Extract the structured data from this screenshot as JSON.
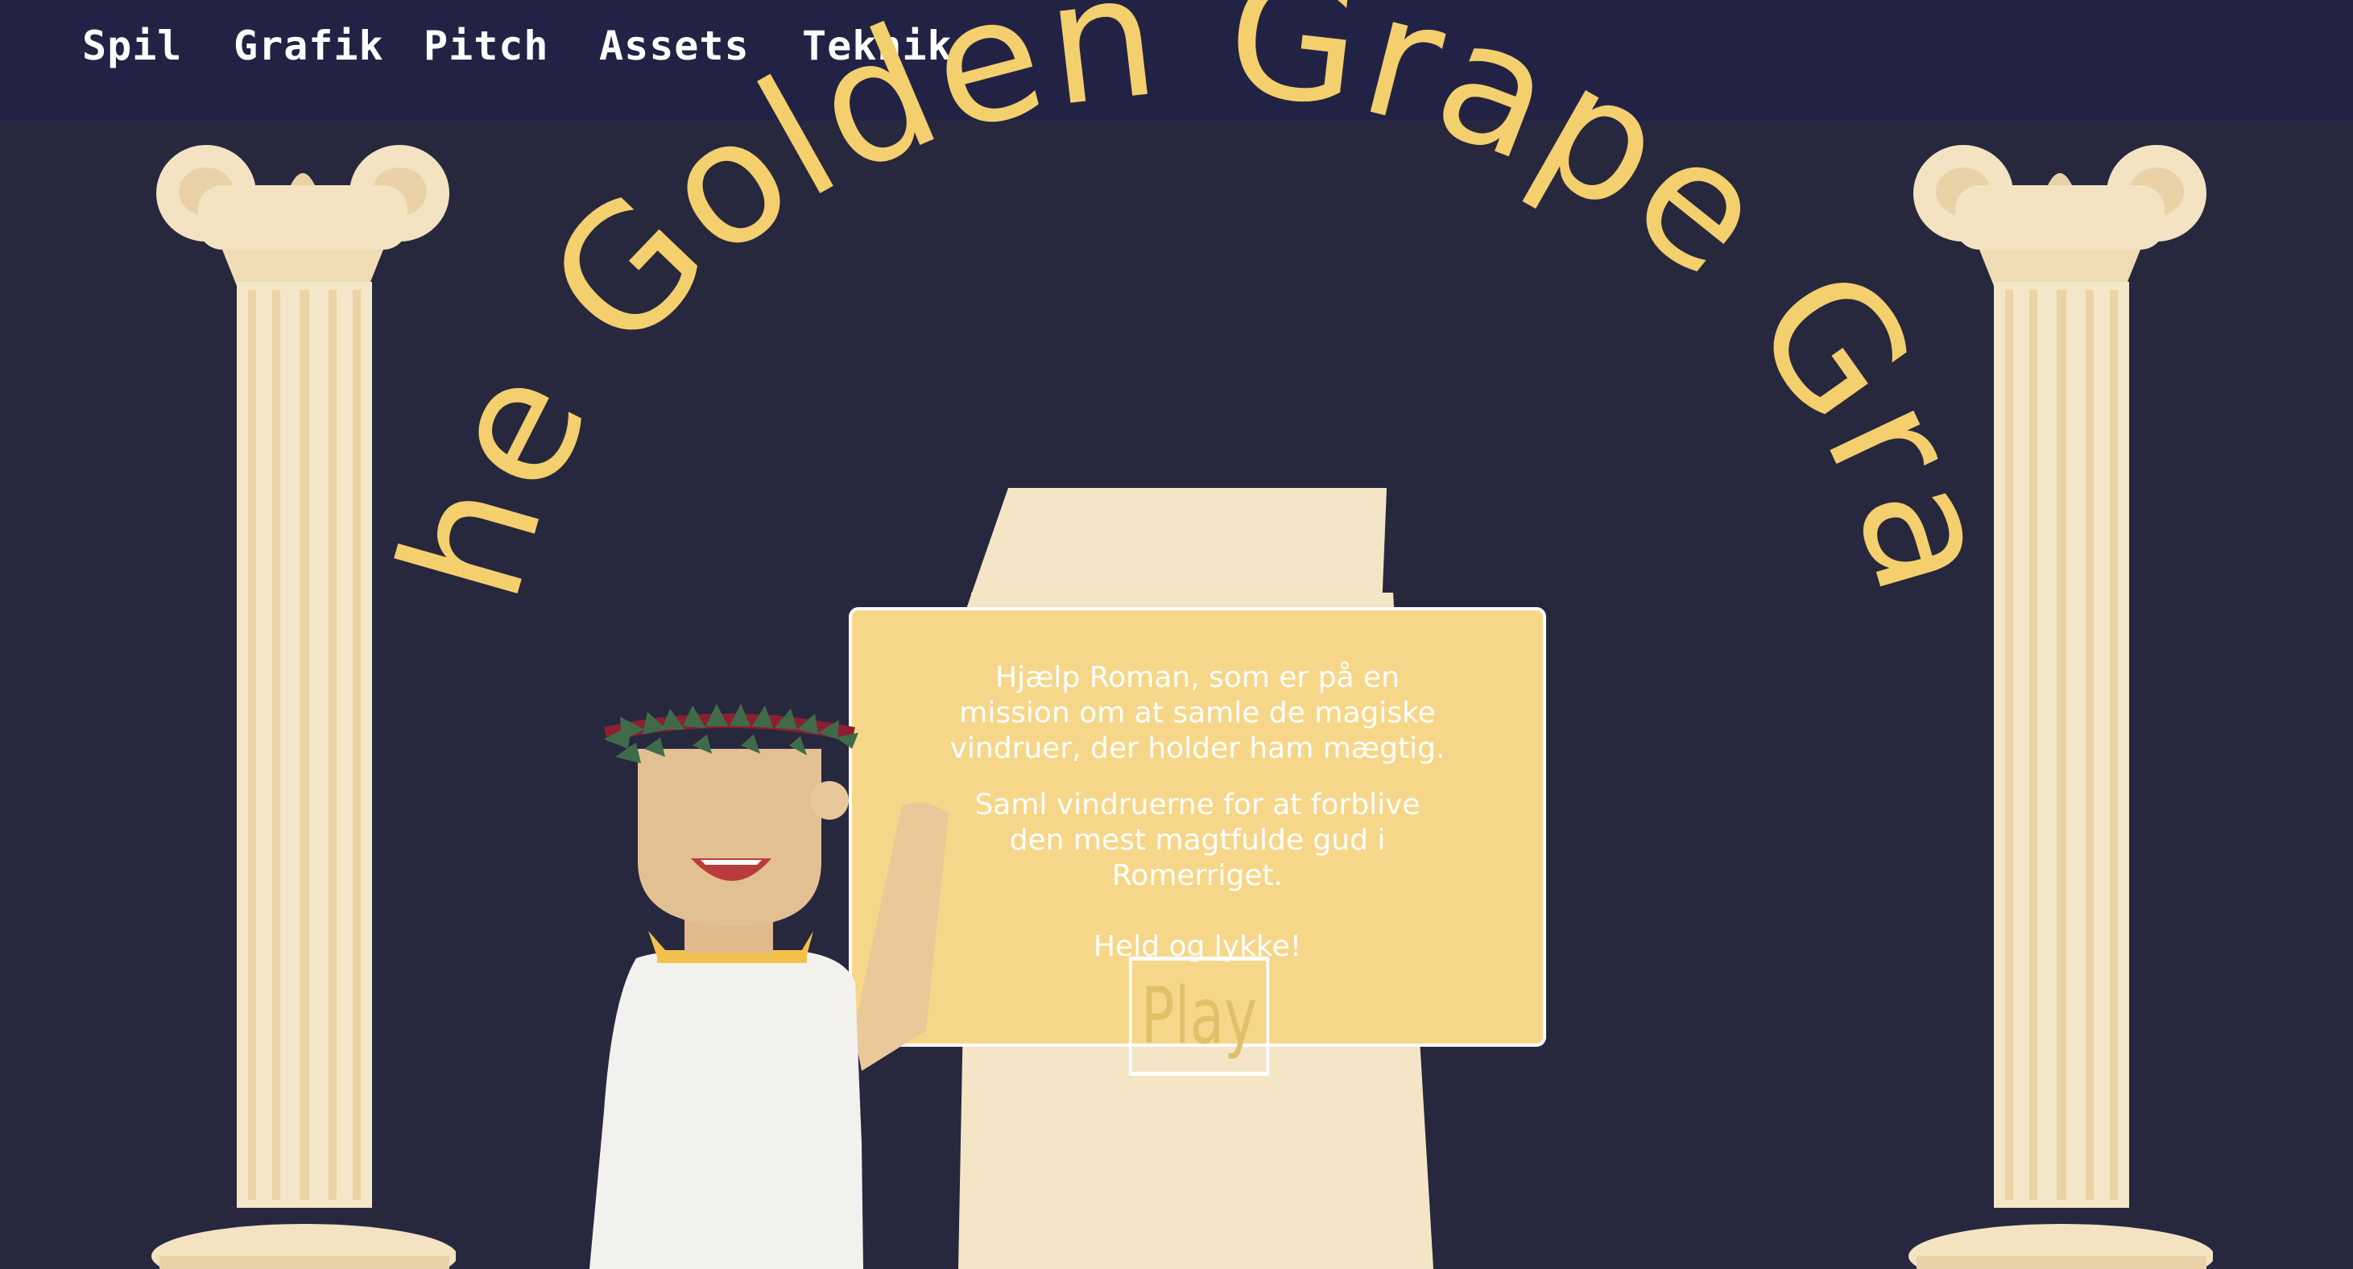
{
  "nav": {
    "items": [
      {
        "label": "Spil"
      },
      {
        "label": "Grafik"
      },
      {
        "label": "Pitch"
      },
      {
        "label": "Assets"
      },
      {
        "label": "Teknik"
      }
    ]
  },
  "game": {
    "title": "The Golden Grape Grab",
    "intro_line_1": "Hjælp Roman, som er på en",
    "intro_line_2": "mission om at samle de magiske",
    "intro_line_3": "vindruer, der holder ham mægtig.",
    "intro_line_4": "Saml vindruerne for at forblive",
    "intro_line_5": "den mest magtfulde gud i",
    "intro_line_6": "Romerriget.",
    "good_luck": "Held og lykke!",
    "play_label": "Play"
  },
  "colors": {
    "background": "#27283d",
    "navbar": "#222344",
    "title": "#f4cf6e",
    "box": "#f6d78a",
    "column": "#f3e3c2",
    "pedestal": "#f4e5c7"
  }
}
